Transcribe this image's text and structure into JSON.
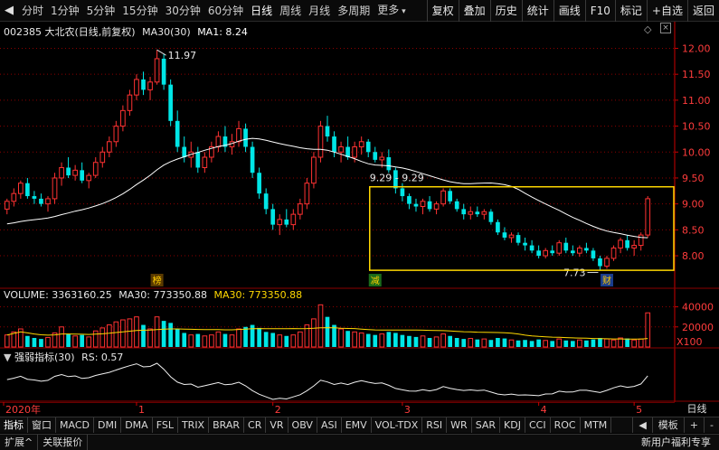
{
  "toolbar": {
    "periods": [
      "分时",
      "1分钟",
      "5分钟",
      "15分钟",
      "30分钟",
      "60分钟",
      "日线",
      "周线",
      "月线",
      "多周期",
      "更多"
    ],
    "active_period": "日线",
    "actions": [
      "复权",
      "叠加",
      "历史",
      "统计",
      "画线",
      "F10",
      "标记",
      "+自选",
      "返回"
    ]
  },
  "main_pane": {
    "stock_code": "002385",
    "stock_name": "大北农",
    "mode": "(日线,前复权)",
    "ma_indicator": "MA30(30)",
    "ma_value": "MA1: 8.24",
    "price_ticks": [
      "12.00",
      "11.50",
      "11.00",
      "10.50",
      "10.00",
      "9.50",
      "9.00",
      "8.50",
      "8.00"
    ],
    "high_label": "11.97",
    "low_label": "7.73",
    "range_label": "9.29 - 9.29",
    "markers": [
      "榜",
      "减",
      "财"
    ]
  },
  "volume_pane": {
    "title": "VOLUME: 3363160.25",
    "ma_label": "MA30: 773350.88",
    "ma_label_yellow": "MA30: 773350.88",
    "ticks": [
      "40000",
      "20000"
    ],
    "unit": "X100"
  },
  "rs_pane": {
    "title": "强弱指标(30)",
    "value": "RS: 0.57"
  },
  "time_axis": {
    "labels": [
      "2020年",
      "1",
      "2",
      "3",
      "4",
      "5"
    ],
    "period": "日线"
  },
  "indicator_tabs": {
    "label": "指标",
    "window": "窗口",
    "items": [
      "MACD",
      "DMI",
      "DMA",
      "FSL",
      "TRIX",
      "BRAR",
      "CR",
      "VR",
      "OBV",
      "ASI",
      "EMV",
      "VOL-TDX",
      "RSI",
      "WR",
      "SAR",
      "KDJ",
      "CCI",
      "ROC",
      "MTM"
    ],
    "template": "模板",
    "plus": "+",
    "minus": "-"
  },
  "statusbar": {
    "expand": "扩展^",
    "related": "关联报价",
    "promo": "新用户福利专享"
  },
  "colors": {
    "up": "#ff3232",
    "down": "#00e6e6",
    "ma": "#ffffff",
    "box": "#ffd800",
    "grid": "#8b0000"
  },
  "chart_data": {
    "type": "candlestick",
    "candles": [
      [
        8.9,
        9.1,
        8.8,
        9.05
      ],
      [
        9.05,
        9.3,
        8.95,
        9.2
      ],
      [
        9.2,
        9.45,
        9.1,
        9.4
      ],
      [
        9.4,
        9.5,
        9.1,
        9.15
      ],
      [
        9.15,
        9.25,
        9.0,
        9.1
      ],
      [
        9.1,
        9.2,
        8.95,
        9.0
      ],
      [
        9.0,
        9.15,
        8.85,
        9.1
      ],
      [
        9.1,
        9.6,
        9.0,
        9.5
      ],
      [
        9.5,
        9.8,
        9.35,
        9.7
      ],
      [
        9.7,
        9.9,
        9.5,
        9.55
      ],
      [
        9.55,
        9.75,
        9.45,
        9.65
      ],
      [
        9.65,
        9.8,
        9.4,
        9.45
      ],
      [
        9.45,
        9.6,
        9.3,
        9.55
      ],
      [
        9.55,
        9.9,
        9.5,
        9.8
      ],
      [
        9.8,
        10.1,
        9.7,
        10.0
      ],
      [
        10.0,
        10.3,
        9.9,
        10.2
      ],
      [
        10.2,
        10.6,
        10.1,
        10.5
      ],
      [
        10.5,
        10.9,
        10.4,
        10.8
      ],
      [
        10.8,
        11.2,
        10.7,
        11.1
      ],
      [
        11.1,
        11.5,
        11.0,
        11.4
      ],
      [
        11.4,
        11.55,
        11.1,
        11.2
      ],
      [
        11.2,
        11.45,
        11.0,
        11.35
      ],
      [
        11.35,
        11.97,
        11.3,
        11.8
      ],
      [
        11.8,
        11.9,
        11.2,
        11.3
      ],
      [
        11.3,
        11.4,
        10.5,
        10.6
      ],
      [
        10.6,
        10.8,
        10.0,
        10.1
      ],
      [
        10.1,
        10.3,
        9.8,
        9.9
      ],
      [
        9.9,
        10.2,
        9.7,
        10.0
      ],
      [
        10.0,
        10.1,
        9.6,
        9.7
      ],
      [
        9.7,
        10.0,
        9.6,
        9.9
      ],
      [
        9.9,
        10.2,
        9.8,
        10.1
      ],
      [
        10.1,
        10.4,
        10.0,
        10.3
      ],
      [
        10.3,
        10.5,
        10.0,
        10.1
      ],
      [
        10.1,
        10.35,
        9.95,
        10.2
      ],
      [
        10.2,
        10.6,
        10.1,
        10.45
      ],
      [
        10.45,
        10.55,
        10.0,
        10.1
      ],
      [
        10.1,
        10.2,
        9.5,
        9.6
      ],
      [
        9.6,
        9.7,
        9.1,
        9.2
      ],
      [
        9.2,
        9.3,
        8.8,
        8.9
      ],
      [
        8.9,
        9.0,
        8.5,
        8.6
      ],
      [
        8.6,
        8.8,
        8.4,
        8.7
      ],
      [
        8.7,
        8.9,
        8.55,
        8.6
      ],
      [
        8.6,
        8.9,
        8.5,
        8.8
      ],
      [
        8.8,
        9.1,
        8.7,
        9.0
      ],
      [
        9.0,
        9.5,
        8.9,
        9.4
      ],
      [
        9.4,
        10.0,
        9.3,
        9.9
      ],
      [
        9.9,
        10.6,
        9.8,
        10.5
      ],
      [
        10.5,
        10.7,
        10.2,
        10.3
      ],
      [
        10.3,
        10.4,
        9.9,
        10.0
      ],
      [
        10.0,
        10.2,
        9.8,
        10.1
      ],
      [
        10.1,
        10.3,
        9.85,
        9.9
      ],
      [
        9.9,
        10.2,
        9.8,
        10.1
      ],
      [
        10.1,
        10.3,
        9.95,
        10.2
      ],
      [
        10.2,
        10.25,
        9.9,
        10.0
      ],
      [
        10.0,
        10.1,
        9.8,
        9.85
      ],
      [
        9.85,
        10.0,
        9.7,
        9.9
      ],
      [
        9.9,
        10.05,
        9.6,
        9.65
      ],
      [
        9.65,
        9.7,
        9.2,
        9.3
      ],
      [
        9.3,
        9.4,
        9.05,
        9.15
      ],
      [
        9.15,
        9.2,
        8.9,
        9.0
      ],
      [
        9.0,
        9.1,
        8.85,
        8.95
      ],
      [
        8.95,
        9.1,
        8.8,
        9.05
      ],
      [
        9.05,
        9.15,
        8.85,
        8.9
      ],
      [
        8.9,
        9.05,
        8.8,
        9.0
      ],
      [
        9.0,
        9.3,
        8.95,
        9.25
      ],
      [
        9.25,
        9.3,
        9.0,
        9.05
      ],
      [
        9.05,
        9.1,
        8.85,
        8.9
      ],
      [
        8.9,
        9.0,
        8.7,
        8.8
      ],
      [
        8.8,
        8.95,
        8.7,
        8.85
      ],
      [
        8.85,
        8.95,
        8.75,
        8.8
      ],
      [
        8.8,
        8.9,
        8.7,
        8.85
      ],
      [
        8.85,
        8.9,
        8.6,
        8.65
      ],
      [
        8.65,
        8.7,
        8.4,
        8.45
      ],
      [
        8.45,
        8.55,
        8.3,
        8.35
      ],
      [
        8.35,
        8.45,
        8.25,
        8.4
      ],
      [
        8.4,
        8.45,
        8.2,
        8.25
      ],
      [
        8.25,
        8.35,
        8.1,
        8.2
      ],
      [
        8.2,
        8.3,
        8.05,
        8.1
      ],
      [
        8.1,
        8.2,
        7.95,
        8.0
      ],
      [
        8.0,
        8.15,
        7.95,
        8.1
      ],
      [
        8.1,
        8.2,
        8.0,
        8.05
      ],
      [
        8.05,
        8.3,
        8.0,
        8.25
      ],
      [
        8.25,
        8.35,
        8.05,
        8.1
      ],
      [
        8.1,
        8.2,
        8.0,
        8.05
      ],
      [
        8.05,
        8.2,
        7.98,
        8.15
      ],
      [
        8.15,
        8.25,
        8.05,
        8.1
      ],
      [
        8.1,
        8.15,
        7.9,
        7.95
      ],
      [
        7.95,
        8.0,
        7.73,
        7.8
      ],
      [
        7.8,
        8.0,
        7.75,
        7.95
      ],
      [
        7.95,
        8.2,
        7.9,
        8.15
      ],
      [
        8.15,
        8.35,
        8.05,
        8.3
      ],
      [
        8.3,
        8.4,
        8.1,
        8.15
      ],
      [
        8.15,
        8.3,
        8.0,
        8.2
      ],
      [
        8.2,
        8.45,
        8.1,
        8.4
      ],
      [
        8.4,
        9.15,
        8.35,
        9.1
      ]
    ],
    "volume": [
      12000,
      15000,
      18000,
      11000,
      9000,
      8000,
      9500,
      14000,
      20000,
      13000,
      11000,
      12000,
      10000,
      16000,
      19000,
      22000,
      25000,
      27000,
      28000,
      30000,
      22000,
      18000,
      30000,
      26000,
      24000,
      18000,
      14000,
      12000,
      13000,
      11000,
      12000,
      15000,
      13000,
      12000,
      18000,
      20000,
      22000,
      19000,
      15000,
      14000,
      12000,
      11000,
      12000,
      15000,
      22000,
      28000,
      42000,
      30000,
      22000,
      18000,
      16000,
      15000,
      14000,
      13000,
      12000,
      13000,
      15000,
      14000,
      12000,
      11000,
      10000,
      11000,
      9000,
      10000,
      13000,
      11000,
      9000,
      8000,
      8500,
      7500,
      8000,
      7000,
      9000,
      8500,
      7000,
      6500,
      7000,
      6000,
      7500,
      6500,
      6000,
      8000,
      6500,
      6000,
      7000,
      6500,
      7500,
      9000,
      8000,
      7000,
      9000,
      8500,
      7000,
      8000,
      34000
    ],
    "ylim": [
      7.6,
      12.2
    ],
    "x_labels": [
      "2020年",
      "1",
      "2",
      "3",
      "4",
      "5"
    ]
  }
}
